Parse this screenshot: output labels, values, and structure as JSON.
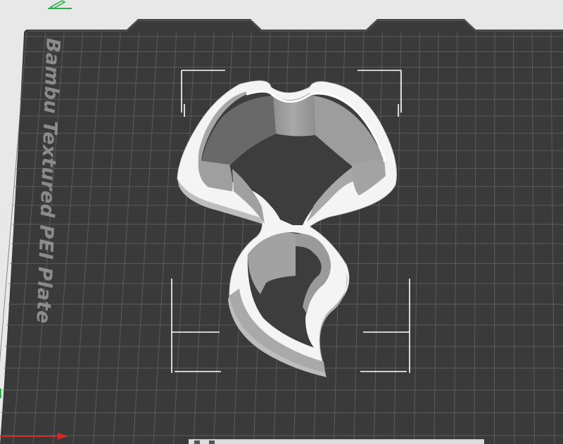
{
  "plate": {
    "label": "Bambu Textured PEI Plate"
  },
  "colors": {
    "background": "#e8e8e8",
    "plate": "#3a3a3a",
    "grid": "#6d6d6d",
    "model_top": "#f2f2f2",
    "model_wall": "#9b9b9b",
    "x_axis": "#d42a2a",
    "y_axis": "#2ab34a"
  },
  "icons": {
    "edit": "pencil-icon",
    "x_axis": "x-axis-arrow-icon",
    "y_axis": "y-axis-indicator-icon"
  },
  "toolbar": {
    "bottom_label": "",
    "unit_label": ""
  }
}
